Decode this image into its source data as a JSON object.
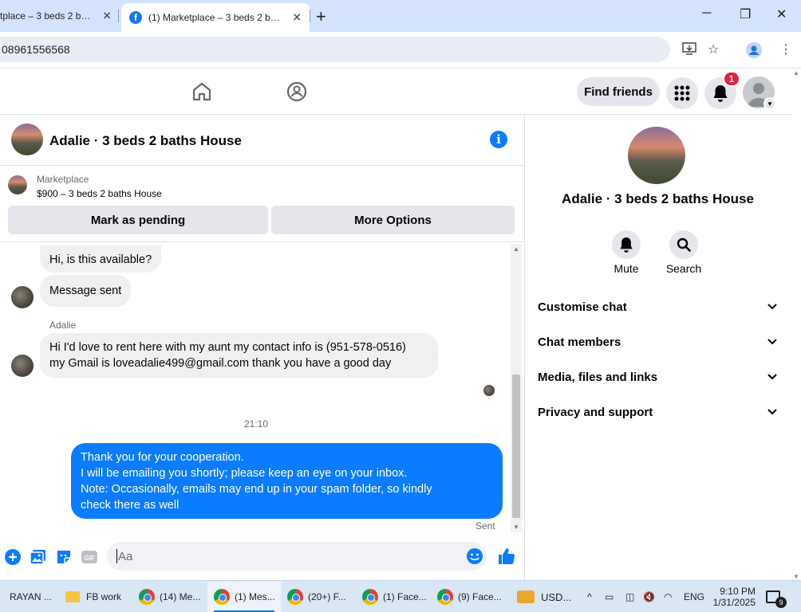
{
  "browser": {
    "tabs": [
      {
        "label": "tplace – 3 beds 2 baths"
      },
      {
        "label": "(1) Marketplace – 3 beds 2 bath"
      }
    ],
    "address": "08961556568"
  },
  "fb_header": {
    "find_friends_label": "Find friends",
    "notification_count": "1"
  },
  "conversation": {
    "title": "Adalie · 3 beds 2 baths House",
    "marketplace": {
      "category": "Marketplace",
      "listing": "$900 – 3 beds 2 baths House",
      "mark_pending_label": "Mark as pending",
      "more_options_label": "More Options"
    },
    "messages": [
      {
        "from": "me",
        "text": "Hi, is this available?"
      },
      {
        "from": "me",
        "text": "Message sent"
      },
      {
        "sender": "Adalie",
        "line1": "Hi I'd love to rent here with my aunt my contact info is (951-578-0516)",
        "line2": "my Gmail is loveadalie499@gmail.com thank you have a good day"
      }
    ],
    "time_divider": "21:10",
    "outgoing": {
      "lines": [
        "Thank you for your cooperation.",
        "I will be emailing you shortly; please keep an eye on your inbox.",
        "Note: Occasionally, emails may end up in your spam folder, so kindly",
        "check there as well"
      ],
      "status": "Sent"
    },
    "composer_placeholder": "Aa"
  },
  "right_panel": {
    "name": "Adalie · 3 beds 2 baths House",
    "mute_label": "Mute",
    "search_label": "Search",
    "sections": [
      "Customise chat",
      "Chat members",
      "Media, files and links",
      "Privacy and support"
    ]
  },
  "taskbar": {
    "items": [
      "RAYAN ...",
      "FB work",
      "(14) Me...",
      "(1) Mes...",
      "(20+) F...",
      "(1) Face...",
      "(9) Face..."
    ],
    "currency": "USD...",
    "language": "ENG",
    "time": "9:10 PM",
    "date": "1/31/2025",
    "notification_count": "9"
  },
  "colors": {
    "messenger_blue": "#0a7cff",
    "fb_blue": "#1877f2",
    "badge_red": "#e41e3f"
  }
}
